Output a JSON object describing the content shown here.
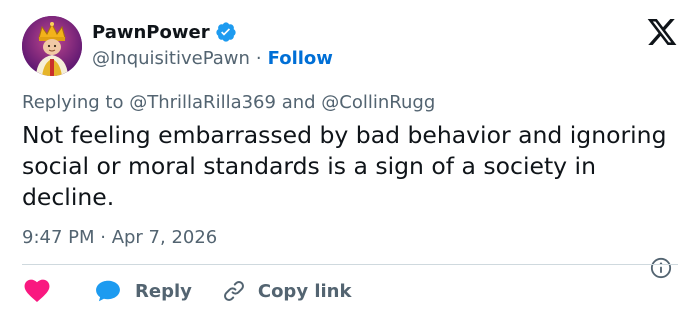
{
  "author": {
    "display_name": "PawnPower",
    "handle": "@InquisitivePawn",
    "separator": "·",
    "follow_label": "Follow",
    "verified": true,
    "avatar_icon": "chess-king-avatar"
  },
  "brand": {
    "logo_icon": "x-logo-icon"
  },
  "reply_context": {
    "prefix": "Replying to",
    "mention_1": "@ThrillaRilla369",
    "joiner": "and",
    "mention_2": "@CollinRugg"
  },
  "tweet": {
    "text": "Not feeling embarrassed by bad behavior and ignoring social or moral standards is a sign of a society in decline.",
    "timestamp": "9:47 PM · Apr 7, 2026"
  },
  "actions": {
    "like_icon": "heart-icon",
    "reply_icon": "reply-bubble-icon",
    "reply_label": "Reply",
    "copy_icon": "link-icon",
    "copy_label": "Copy link",
    "info_icon": "info-icon"
  },
  "colors": {
    "accent": "#1d9bf0",
    "link": "#006fd6",
    "like": "#f91880",
    "text": "#0f1419",
    "muted": "#536471",
    "divider": "#cfd9de"
  }
}
